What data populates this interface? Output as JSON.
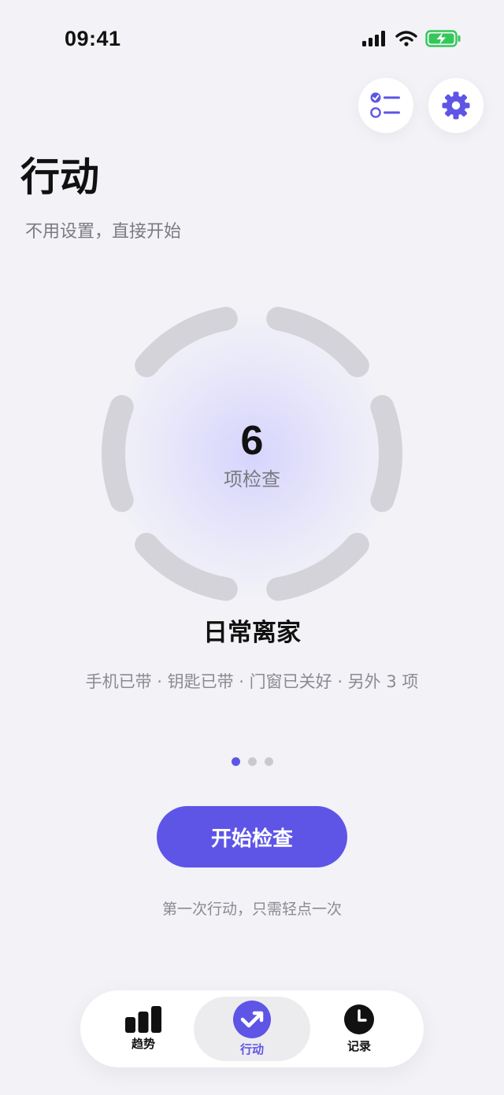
{
  "status_bar": {
    "time": "09:41"
  },
  "header": {
    "title": "行动",
    "subtitle": "不用设置，直接开始"
  },
  "ring": {
    "count": "6",
    "unit": "项检查"
  },
  "scene": {
    "name": "日常离家",
    "items_summary": "手机已带 · 钥匙已带 · 门窗已关好 · 另外 3 项"
  },
  "pager": {
    "total_pages": 3,
    "active_page": 1
  },
  "primary_action": {
    "label": "开始检查",
    "hint": "第一次行动，只需轻点一次"
  },
  "tabs": [
    {
      "label": "趋势",
      "icon": "bar-chart-icon",
      "active": false
    },
    {
      "label": "行动",
      "icon": "check-arrow-icon",
      "active": true
    },
    {
      "label": "记录",
      "icon": "clock-icon",
      "active": false
    }
  ],
  "colors": {
    "accent": "#5e55e6",
    "background": "#f2f2f7",
    "ring_segment": "#d3d3d9",
    "battery": "#34c759"
  }
}
